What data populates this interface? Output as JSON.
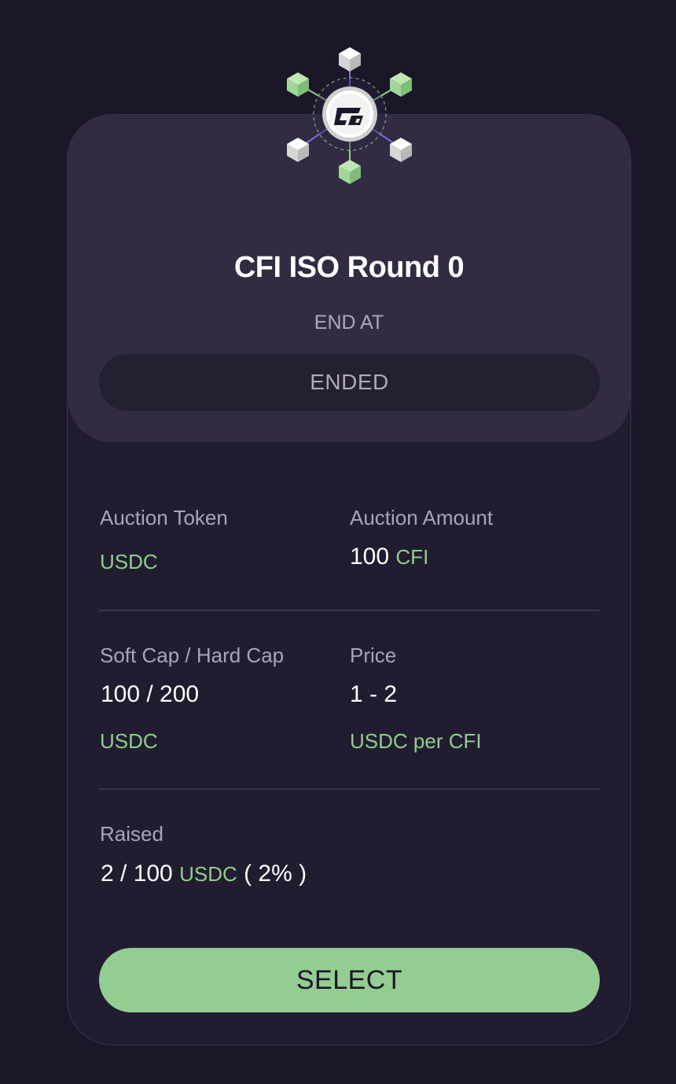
{
  "card": {
    "logo_alt": "CFI",
    "title": "CFI ISO Round 0",
    "end_label": "END AT",
    "status": "ENDED"
  },
  "fields": {
    "auction_token": {
      "label": "Auction Token",
      "value": "USDC"
    },
    "auction_amount": {
      "label": "Auction Amount",
      "amount": "100",
      "unit": "CFI"
    },
    "caps": {
      "label": "Soft Cap / Hard Cap",
      "value": "100 / 200",
      "unit": "USDC"
    },
    "price": {
      "label": "Price",
      "value": "1 - 2",
      "unit": "USDC per CFI"
    },
    "raised": {
      "label": "Raised",
      "value": "2 / 100",
      "unit": "USDC",
      "percent": "( 2% )",
      "progress_fraction": 0.02
    }
  },
  "actions": {
    "select_label": "SELECT"
  },
  "colors": {
    "background": "#1c1629",
    "card": "#221c30",
    "card_top": "#322b42",
    "accent_green": "#8fcf8c",
    "button": "#93cd92"
  },
  "icons": [
    "cfi-network-logo-icon",
    "cube-icon"
  ]
}
